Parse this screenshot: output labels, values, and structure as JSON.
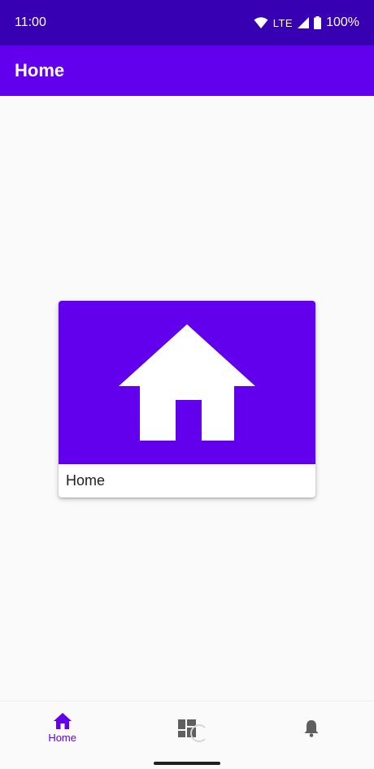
{
  "status_bar": {
    "time": "11:00",
    "network": "LTE",
    "battery": "100%",
    "icons": [
      "wifi-icon",
      "signal-icon",
      "battery-icon"
    ]
  },
  "app_bar": {
    "title": "Home"
  },
  "card": {
    "label": "Home",
    "icon": "home-icon",
    "media_color": "#6200ee"
  },
  "bottom_nav": {
    "items": [
      {
        "label": "Home",
        "icon": "home-icon",
        "active": true
      },
      {
        "label": "",
        "icon": "dashboard-icon",
        "active": false
      },
      {
        "label": "",
        "icon": "notifications-icon",
        "active": false
      }
    ]
  },
  "colors": {
    "primary": "#6200ee",
    "primary_dark": "#3700b3",
    "background": "#fafafa"
  }
}
